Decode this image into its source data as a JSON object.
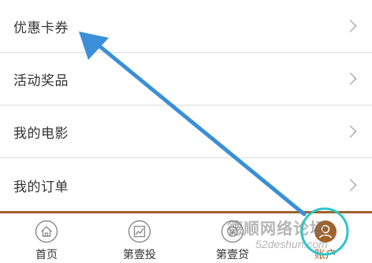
{
  "menu": {
    "items": [
      {
        "label": "优惠卡券"
      },
      {
        "label": "活动奖品"
      },
      {
        "label": "我的电影"
      },
      {
        "label": "我的订单"
      }
    ]
  },
  "tabbar": {
    "tabs": [
      {
        "label": "首页",
        "icon": "home-icon"
      },
      {
        "label": "第壹投",
        "icon": "invest-chart-icon"
      },
      {
        "label": "第壹贷",
        "icon": "loan-icon"
      },
      {
        "label": "账户",
        "icon": "account-avatar-icon",
        "active": true
      }
    ],
    "accent_color": "#a0622c"
  },
  "annotation": {
    "arrow_color": "#3a8fd8",
    "circle_color": "#2ec4c9"
  },
  "watermark": {
    "text": "德顺网络论坛",
    "url": "52deshun.com"
  }
}
